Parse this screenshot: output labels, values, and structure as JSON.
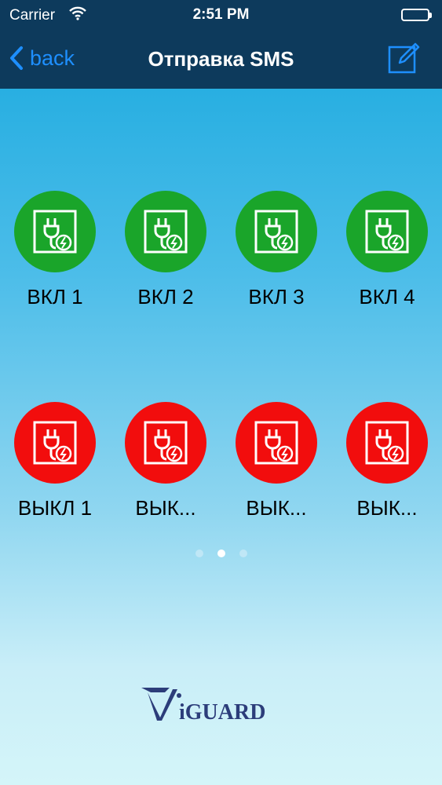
{
  "status_bar": {
    "carrier": "Carrier",
    "time": "2:51 PM",
    "wifi_icon": "wifi-icon",
    "battery_icon": "battery-icon"
  },
  "nav": {
    "back_label": "back",
    "title": "Отправка SMS",
    "compose_icon": "compose-icon"
  },
  "colors": {
    "nav_bg": "#0d3a5c",
    "accent": "#1e8fff",
    "on_green": "#1aa52a",
    "off_red": "#f20d0d"
  },
  "on_buttons": [
    {
      "label": "ВКЛ 1"
    },
    {
      "label": "ВКЛ 2"
    },
    {
      "label": "ВКЛ 3"
    },
    {
      "label": "ВКЛ 4"
    }
  ],
  "off_buttons": [
    {
      "label": "ВЫКЛ 1"
    },
    {
      "label": "ВЫК..."
    },
    {
      "label": "ВЫК..."
    },
    {
      "label": "ВЫК..."
    }
  ],
  "pager": {
    "count": 3,
    "active": 2
  },
  "logo": {
    "text": "ViGUARD"
  }
}
